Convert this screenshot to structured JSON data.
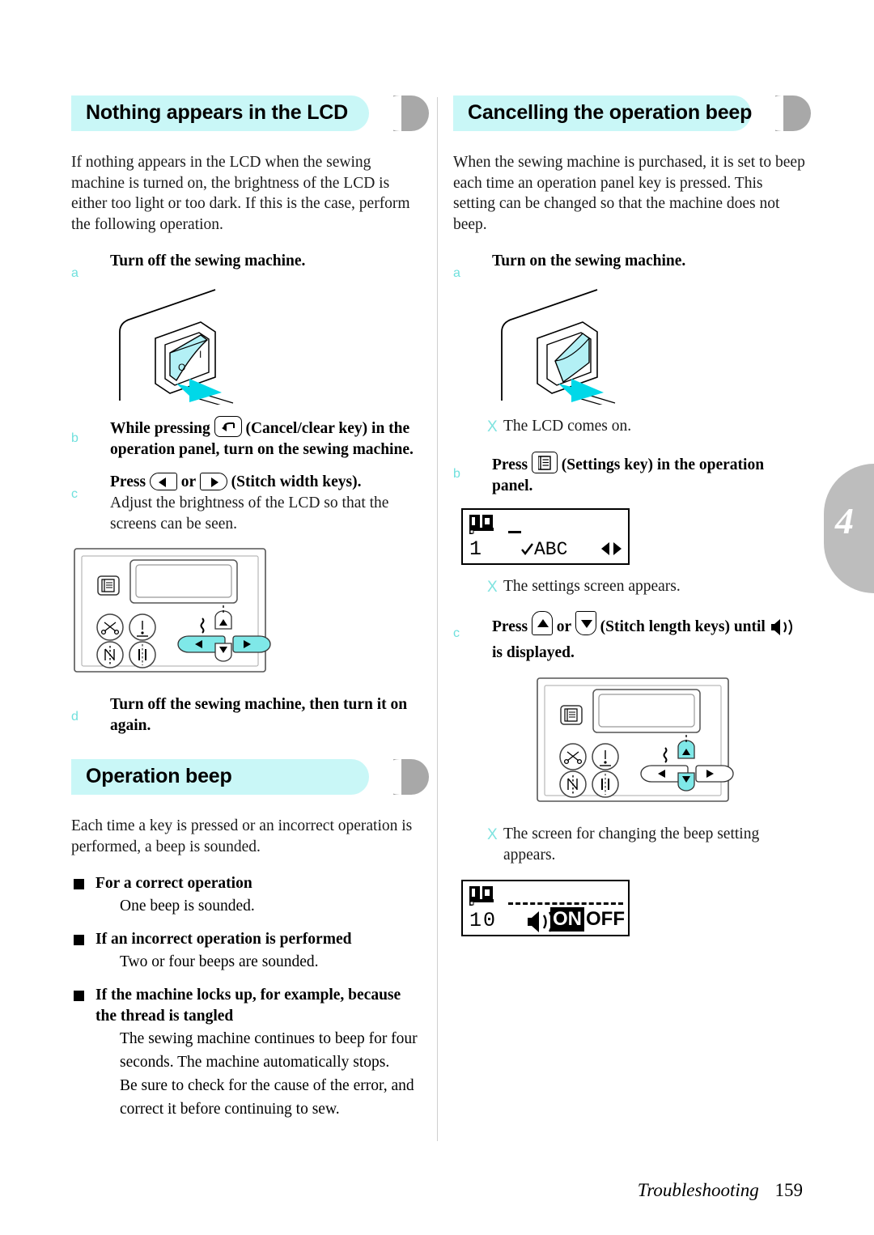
{
  "chapter_tab": {
    "number": "4"
  },
  "footer": {
    "section": "Troubleshooting",
    "page": "159"
  },
  "left_column": {
    "section1": {
      "heading": "Nothing appears in the LCD",
      "intro": "If nothing appears in the LCD when the sewing machine is turned on, the brightness of the LCD is either too light or too dark. If this is the case, perform the following operation.",
      "steps": [
        {
          "marker": "a",
          "heading": "Turn off the sewing machine.",
          "sub": ""
        },
        {
          "marker": "b",
          "heading_pre": "While pressing",
          "key": "cancel-clear-key",
          "heading_post": "(Cancel/clear key) in the operation panel, turn on the sewing machine.",
          "sub": ""
        },
        {
          "marker": "c",
          "heading_pre": "Press",
          "heading_mid": "or",
          "heading_post": "(Stitch width keys).",
          "sub": "Adjust the brightness of the LCD so that the screens can be seen."
        },
        {
          "marker": "d",
          "heading": "Turn off the sewing machine, then turn it on again.",
          "sub": ""
        }
      ]
    },
    "section2": {
      "heading": "Operation beep",
      "intro": "Each time a key is pressed or an incorrect operation is performed, a beep is sounded.",
      "items": [
        {
          "label": "For a correct operation",
          "body": "One beep is sounded."
        },
        {
          "label": "If an incorrect operation is performed",
          "body": "Two or four beeps are sounded."
        },
        {
          "label": "If the machine locks up, for example, because the thread is tangled",
          "body": "The sewing machine continues to beep for four seconds. The machine automatically stops.\nBe sure to check for the cause of the error, and correct it before continuing to sew."
        }
      ]
    }
  },
  "right_column": {
    "section1": {
      "heading": "Cancelling the operation beep",
      "intro": "When the sewing machine is purchased, it is set to beep each time an operation panel key is pressed. This setting can be changed so that the machine does not beep.",
      "steps": [
        {
          "marker": "a",
          "heading": "Turn on the sewing machine."
        },
        {
          "marker": "b",
          "heading_pre": "Press",
          "heading_post": "(Settings key) in the operation panel."
        },
        {
          "marker": "c",
          "heading_pre": "Press",
          "heading_mid": "or",
          "heading_post": "(Stitch length keys) until",
          "heading_tail": "is displayed."
        }
      ],
      "results": [
        {
          "text": "The LCD comes on."
        },
        {
          "text": "The settings screen appears."
        },
        {
          "text": "The screen for changing the beep setting appears."
        }
      ]
    }
  },
  "lcd_screens": {
    "settings_screen": {
      "number": "1",
      "label": "ABC"
    },
    "beep_screen": {
      "number": "10",
      "on": "ON",
      "off": "OFF"
    }
  },
  "colors": {
    "banner_bg": "#c9f7f7",
    "banner_halfmoon": "#a8a8a8",
    "marker": "#6fe0dd",
    "highlight_cyan": "#7fe8e8",
    "arrow_cyan": "#00d8e8",
    "chapter_tab": "#bdbdbd"
  }
}
